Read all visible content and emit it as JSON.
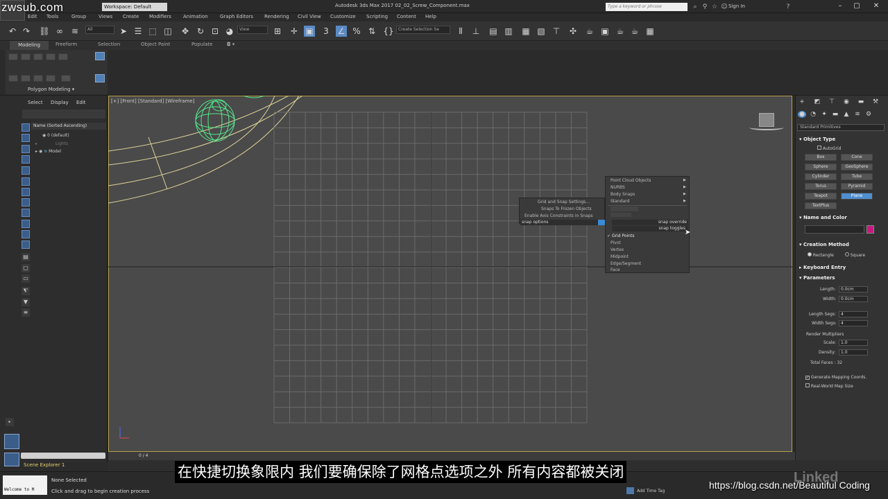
{
  "watermarks": {
    "top_left": "zwsub.com",
    "bottom_right": "https://blog.csdn.net/Beautiful Coding",
    "brand": "Linked"
  },
  "titlebar": {
    "workspace": "Workspace: Default",
    "title": "Autodesk 3ds Max 2017    02_02_Screw_Component.max",
    "search_placeholder": "Type a keyword or phrase",
    "sign_in": "Sign In"
  },
  "menu": [
    "Edit",
    "Tools",
    "Group",
    "Views",
    "Create",
    "Modifiers",
    "Animation",
    "Graph Editors",
    "Rendering",
    "Civil View",
    "Customize",
    "Scripting",
    "Content",
    "Help"
  ],
  "toolbar": {
    "filter": "All",
    "ref_coord": "View",
    "selection_set": "Create Selection Se"
  },
  "ribbon": {
    "tabs": [
      "Modeling",
      "Freeform",
      "Selection",
      "Object Paint",
      "Populate"
    ],
    "group_label": "Polygon Modeling"
  },
  "scene_explorer": {
    "tabs": [
      "Select",
      "Display",
      "Edit"
    ],
    "header": "Name (Sorted Ascending)",
    "rows": [
      "0 (default)",
      "Lights",
      "Model"
    ],
    "footer": "Scene Explorer 1"
  },
  "viewport": {
    "label": "[+] [Front] [Standard] [Wireframe]"
  },
  "quad_left": {
    "items": [
      "Grid and Snap Settings...",
      "Snaps To Frozen Objects",
      "Enable Axis Constraints in Snaps"
    ],
    "title": "snap options"
  },
  "quad_right": {
    "top_items": [
      "Point Cloud Objects",
      "NURBS",
      "Body Snaps",
      "Standard",
      "",
      ""
    ],
    "title_override": "snap override",
    "title_toggles": "snap toggles",
    "snap_items": [
      "Grid Points",
      "Pivot",
      "Vertex",
      "Midpoint",
      "Edge/Segment",
      "Face"
    ]
  },
  "command_panel": {
    "category": "Standard Primitives",
    "object_type_title": "Object Type",
    "autogrid": "AutoGrid",
    "primitives": [
      "Box",
      "Cone",
      "Sphere",
      "GeoSphere",
      "Cylinder",
      "Tube",
      "Torus",
      "Pyramid",
      "Teapot",
      "Plane",
      "TextPlus"
    ],
    "name_color_title": "Name and Color",
    "creation_method_title": "Creation Method",
    "creation_methods": [
      "Rectangle",
      "Square"
    ],
    "keyboard_entry_title": "Keyboard Entry",
    "parameters_title": "Parameters",
    "length_label": "Length:",
    "length_value": "0.0cm",
    "width_label": "Width:",
    "width_value": "0.0cm",
    "length_segs_label": "Length Segs:",
    "length_segs_value": "4",
    "width_segs_label": "Width Segs:",
    "width_segs_value": "4",
    "render_multipliers": "Render Multipliers",
    "scale_label": "Scale:",
    "scale_value": "1.0",
    "density_label": "Density:",
    "density_value": "1.0",
    "total_faces": "Total Faces : 32",
    "gen_mapping": "Generate Mapping Coords.",
    "real_world": "Real-World Map Size"
  },
  "timeline": {
    "frame": "0 / 4"
  },
  "status": {
    "maxscript": "Welcome to M",
    "none_selected": "None Selected",
    "prompt": "Click and drag to begin creation process",
    "add_time_tag": "Add Time Tag"
  },
  "subtitle": "在快捷切换象限内  我们要确保除了网格点选项之外  所有内容都被关闭",
  "colors": {
    "accent": "#4f8fcf",
    "viewport_border": "#b6a24c",
    "object_green": "#54e88c",
    "swatch": "#c8187e"
  }
}
